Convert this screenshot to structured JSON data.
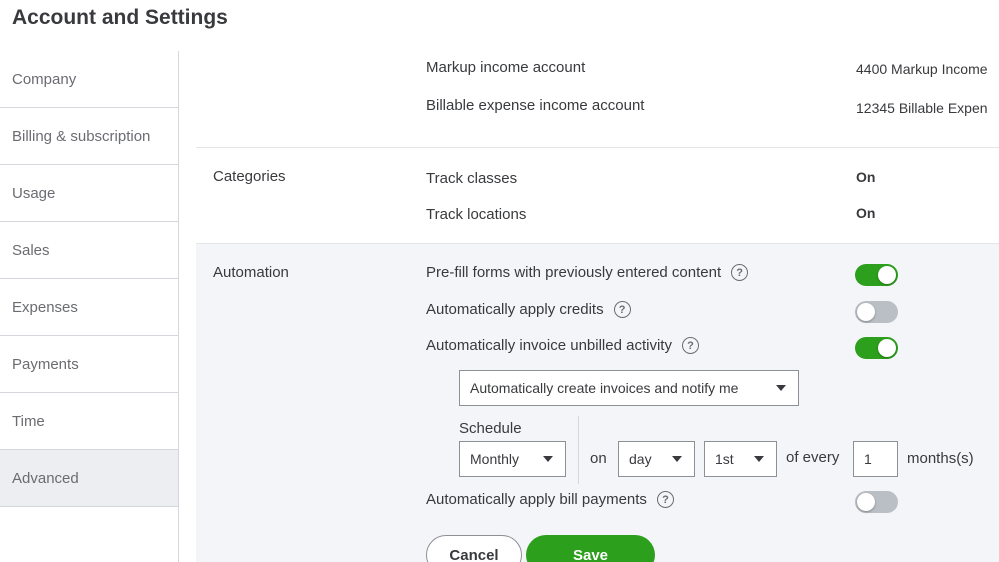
{
  "page": {
    "title": "Account and Settings"
  },
  "sidebar": {
    "items": [
      {
        "label": "Company"
      },
      {
        "label": "Billing & subscription"
      },
      {
        "label": "Usage"
      },
      {
        "label": "Sales"
      },
      {
        "label": "Expenses"
      },
      {
        "label": "Payments"
      },
      {
        "label": "Time"
      },
      {
        "label": "Advanced",
        "active": true
      }
    ]
  },
  "accounts_section": {
    "rows": [
      {
        "label": "Markup income account",
        "value": "4400 Markup Income"
      },
      {
        "label": "Billable expense income account",
        "value": "12345 Billable Expen"
      }
    ]
  },
  "categories": {
    "title": "Categories",
    "rows": [
      {
        "label": "Track classes",
        "value": "On"
      },
      {
        "label": "Track locations",
        "value": "On"
      }
    ]
  },
  "automation": {
    "title": "Automation",
    "rows": [
      {
        "label": "Pre-fill forms with previously entered content",
        "enabled": true
      },
      {
        "label": "Automatically apply credits",
        "enabled": false
      },
      {
        "label": "Automatically invoice unbilled activity",
        "enabled": true
      },
      {
        "label": "Automatically apply bill payments",
        "enabled": false
      }
    ],
    "invoice_mode": "Automatically create invoices and notify me",
    "schedule": {
      "label": "Schedule",
      "frequency": "Monthly",
      "on_label": "on",
      "unit": "day",
      "day": "1st",
      "of_every_label": "of every",
      "interval": "1",
      "interval_unit_label": "months(s)"
    }
  },
  "help_glyph": "?",
  "buttons": {
    "cancel": "Cancel",
    "save": "Save"
  },
  "colors": {
    "accent": "#2ca01c",
    "panel_bg": "#f4f5f8",
    "active_nav": "#eceef1",
    "toggle_off": "#babec5"
  }
}
